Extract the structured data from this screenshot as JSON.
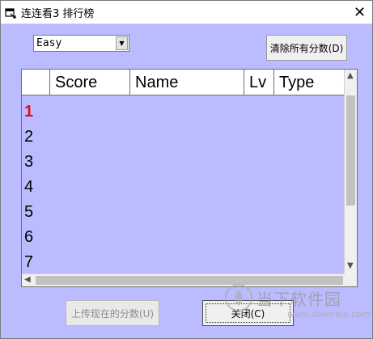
{
  "window": {
    "title": "连连看3 排行榜",
    "close_glyph": "✕"
  },
  "difficulty": {
    "selected": "Easy",
    "arrow_glyph": "▼"
  },
  "buttons": {
    "clear_scores": "清除所有分数(D)",
    "upload_scores": "上传现在的分数(U)",
    "close": "关闭(C)"
  },
  "table": {
    "columns": [
      "",
      "Score",
      "Name",
      "Lv",
      "Type"
    ],
    "row_labels": [
      "1",
      "2",
      "3",
      "4",
      "5",
      "6",
      "7"
    ]
  },
  "watermark": {
    "text": "当下软件园",
    "url": "www.downxia.com"
  },
  "colors": {
    "background": "#bbbbff",
    "first_place": "#e21010"
  }
}
